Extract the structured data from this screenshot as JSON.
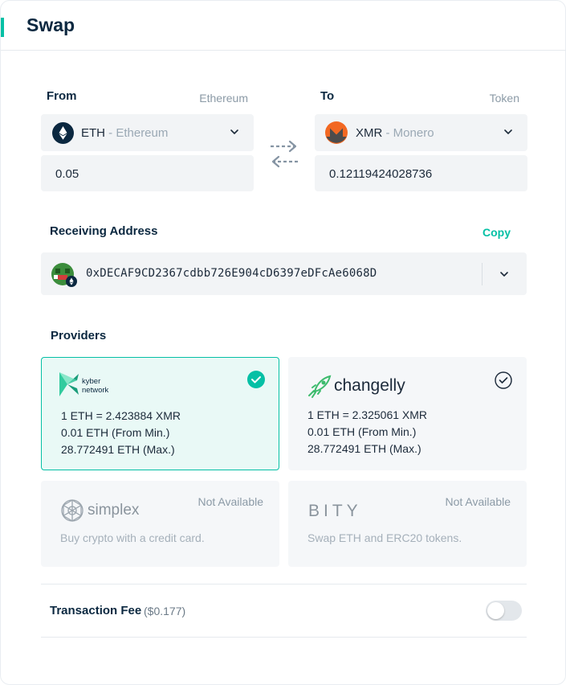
{
  "header": {
    "title": "Swap"
  },
  "from": {
    "label": "From",
    "network_hint": "Ethereum",
    "token_symbol": "ETH",
    "token_name": "- Ethereum",
    "icon": "ethereum-icon",
    "amount": "0.05"
  },
  "to": {
    "label": "To",
    "network_hint": "Token",
    "token_symbol": "XMR",
    "token_name": "- Monero",
    "icon": "monero-icon",
    "amount": "0.12119424028736"
  },
  "receiving": {
    "label": "Receiving Address",
    "copy_label": "Copy",
    "address": "0xDECAF9CD2367cdbb726E904cD6397eDFcAe6068D"
  },
  "providers": {
    "label": "Providers",
    "items": [
      {
        "name": "kyber network",
        "logo_line1": "kyber",
        "logo_line2": "network",
        "rate": "1 ETH = 2.423884 XMR",
        "min": "0.01 ETH (From Min.)",
        "max": "28.772491 ETH (Max.)",
        "selected": true
      },
      {
        "name": "changelly",
        "logo_text": "changelly",
        "rate": "1 ETH = 2.325061 XMR",
        "min": "0.01 ETH (From Min.)",
        "max": "28.772491 ETH (Max.)",
        "selected": false
      },
      {
        "name": "simplex",
        "logo_text": "simplex",
        "status": "Not Available",
        "description": "Buy crypto with a credit card."
      },
      {
        "name": "bity",
        "logo_text": "BITY",
        "status": "Not Available",
        "description": "Swap ETH and ERC20 tokens."
      }
    ]
  },
  "fee": {
    "label": "Transaction Fee",
    "amount": "($0.177)",
    "enabled": false
  },
  "colors": {
    "accent": "#05c0a5",
    "title": "#0b2840",
    "box_bg": "#f2f4f6",
    "monero_orange": "#f26822"
  }
}
